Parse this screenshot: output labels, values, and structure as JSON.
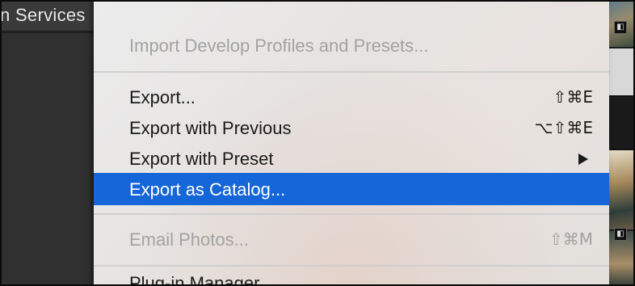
{
  "menubar": {
    "title": "n Services"
  },
  "menu": {
    "items": [
      {
        "label": "Import Develop Profiles and Presets...",
        "shortcut": "",
        "state": "disabled"
      },
      {
        "label": "Export...",
        "shortcut": "⇧⌘E",
        "state": "enabled"
      },
      {
        "label": "Export with Previous",
        "shortcut": "⌥⇧⌘E",
        "state": "enabled"
      },
      {
        "label": "Export with Preset",
        "shortcut": "",
        "submenu": true,
        "state": "enabled"
      },
      {
        "label": "Export as Catalog...",
        "shortcut": "",
        "state": "selected"
      },
      {
        "label": "Email Photos...",
        "shortcut": "⇧⌘M",
        "state": "disabled"
      }
    ],
    "partial_label": "Plug-in Manager..."
  },
  "colors": {
    "selection": "#1566d8",
    "menu_bg": "#ececec",
    "disabled_text": "#a3a3a3"
  },
  "icons": {
    "submenu": "submenu-arrow-icon"
  }
}
